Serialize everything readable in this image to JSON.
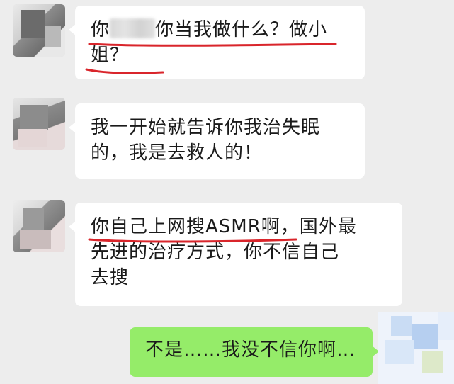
{
  "chat": {
    "messages": [
      {
        "sender": "contact",
        "lines": [
          "你",
          "你当我做什么？做小",
          "姐？"
        ]
      },
      {
        "sender": "contact",
        "lines": [
          "我一开始就告诉你我治失眠",
          "的，我是去救人的！"
        ]
      },
      {
        "sender": "contact",
        "lines": [
          "你自己上网搜ASMR啊，国外最",
          "先进的治疗方式，你不信自己",
          "去搜"
        ]
      },
      {
        "sender": "self",
        "lines": [
          "不是……我没不信你啊…"
        ]
      }
    ]
  },
  "colors": {
    "background": "#ededed",
    "incoming_bubble": "#ffffff",
    "outgoing_bubble": "#95ec69",
    "annotation_underline": "#d9252b"
  },
  "icons": {
    "contact_avatar": "blurred-avatar-icon",
    "self_avatar": "blurred-avatar-icon"
  }
}
